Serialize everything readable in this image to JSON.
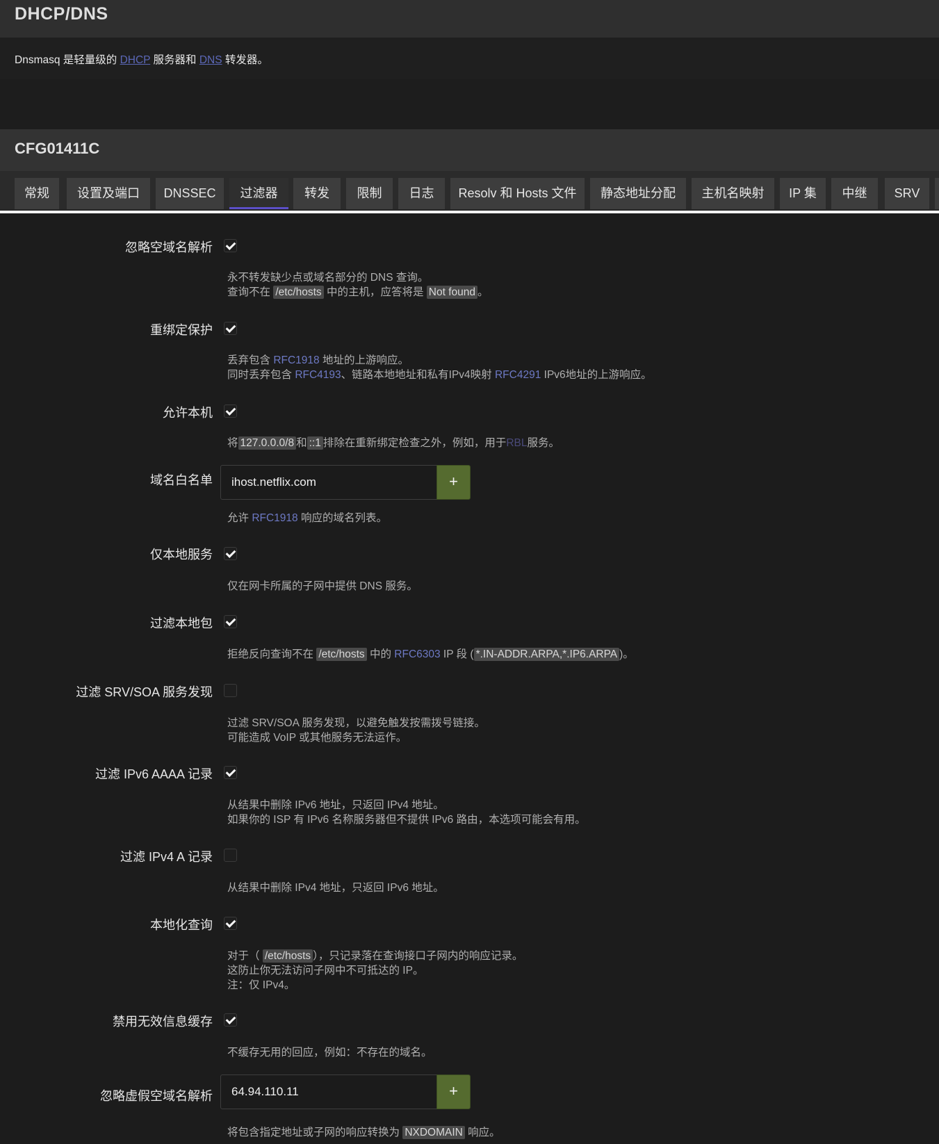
{
  "header": {
    "title": "DHCP/DNS"
  },
  "intro": {
    "prefix": "Dnsmasq 是轻量级的 ",
    "dhcp_link": "DHCP",
    "middle": " 服务器和 ",
    "dns_link": "DNS",
    "suffix": " 转发器。"
  },
  "section": {
    "title": "CFG01411C"
  },
  "tabs": [
    {
      "label": "常规"
    },
    {
      "label": "设置及端口"
    },
    {
      "label": "DNSSEC"
    },
    {
      "label": "过滤器",
      "active": true
    },
    {
      "label": "转发"
    },
    {
      "label": "限制"
    },
    {
      "label": "日志"
    },
    {
      "label": "Resolv 和 Hosts 文件"
    },
    {
      "label": "静态地址分配"
    },
    {
      "label": "主机名映射"
    },
    {
      "label": "IP 集"
    },
    {
      "label": "中继"
    },
    {
      "label": "SRV"
    }
  ],
  "fields": {
    "domain_needed": {
      "label": "忽略空域名解析",
      "checked": true,
      "help1": "永不转发缺少点或域名部分的 DNS 查询。",
      "help2_a": "查询不在 ",
      "help2_code1": "/etc/hosts",
      "help2_b": " 中的主机，应答将是 ",
      "help2_code2": "Not found",
      "help2_c": "。"
    },
    "rebind_protection": {
      "label": "重绑定保护",
      "checked": true,
      "help1_a": "丢弃包含 ",
      "help1_link": "RFC1918",
      "help1_b": " 地址的上游响应。",
      "help2_a": "同时丢弃包含 ",
      "help2_link1": "RFC4193",
      "help2_b": "、链路本地地址和私有IPv4映射 ",
      "help2_link2": "RFC4291",
      "help2_c": " IPv6地址的上游响应。"
    },
    "rebind_localhost": {
      "label": "允许本机",
      "checked": true,
      "help_a": "将",
      "help_code1": "127.0.0.0/8",
      "help_b": "和",
      "help_code2": "::1",
      "help_c": "排除在重新绑定检查之外，例如，用于",
      "help_link": "RBL",
      "help_d": "服务。"
    },
    "rebind_domain": {
      "label": "域名白名单",
      "value": "ihost.netflix.com",
      "add_label": "+",
      "help_a": "允许 ",
      "help_link": "RFC1918",
      "help_b": " 响应的域名列表。"
    },
    "localservice": {
      "label": "仅本地服务",
      "checked": true,
      "help": "仅在网卡所属的子网中提供 DNS 服务。"
    },
    "boguspriv": {
      "label": "过滤本地包",
      "checked": true,
      "help_a": "拒绝反向查询不在 ",
      "help_code1": "/etc/hosts",
      "help_b": " 中的 ",
      "help_link": "RFC6303",
      "help_c": " IP 段 (",
      "help_code2": "*.IN-ADDR.ARPA,*.IP6.ARPA",
      "help_d": ")。"
    },
    "filterwin2k": {
      "label": "过滤 SRV/SOA 服务发现",
      "checked": false,
      "help1": "过滤 SRV/SOA 服务发现，以避免触发按需拨号链接。",
      "help2": "可能造成 VoIP 或其他服务无法运作。"
    },
    "filter_aaaa": {
      "label": "过滤 IPv6 AAAA 记录",
      "checked": true,
      "help1": "从结果中删除 IPv6 地址，只返回 IPv4 地址。",
      "help2": "如果你的 ISP 有 IPv6 名称服务器但不提供 IPv6 路由，本选项可能会有用。"
    },
    "filter_a": {
      "label": "过滤 IPv4 A 记录",
      "checked": false,
      "help": "从结果中删除 IPv4 地址，只返回 IPv6 地址。"
    },
    "localise_queries": {
      "label": "本地化查询",
      "checked": true,
      "help1_a": "对于（ ",
      "help1_code": "/etc/hosts",
      "help1_b": "），只记录落在查询接口子网内的响应记录。",
      "help2": "这防止你无法访问子网中不可抵达的 IP。",
      "help3": "注：仅 IPv4。"
    },
    "nonegcache": {
      "label": "禁用无效信息缓存",
      "checked": true,
      "help": "不缓存无用的回应，例如：不存在的域名。"
    },
    "bogusnxdomain": {
      "label": "忽略虚假空域名解析",
      "value": "64.94.110.11",
      "add_label": "+",
      "help_a": "将包含指定地址或子网的响应转换为 ",
      "help_code": "NXDOMAIN",
      "help_b": " 响应。"
    }
  }
}
